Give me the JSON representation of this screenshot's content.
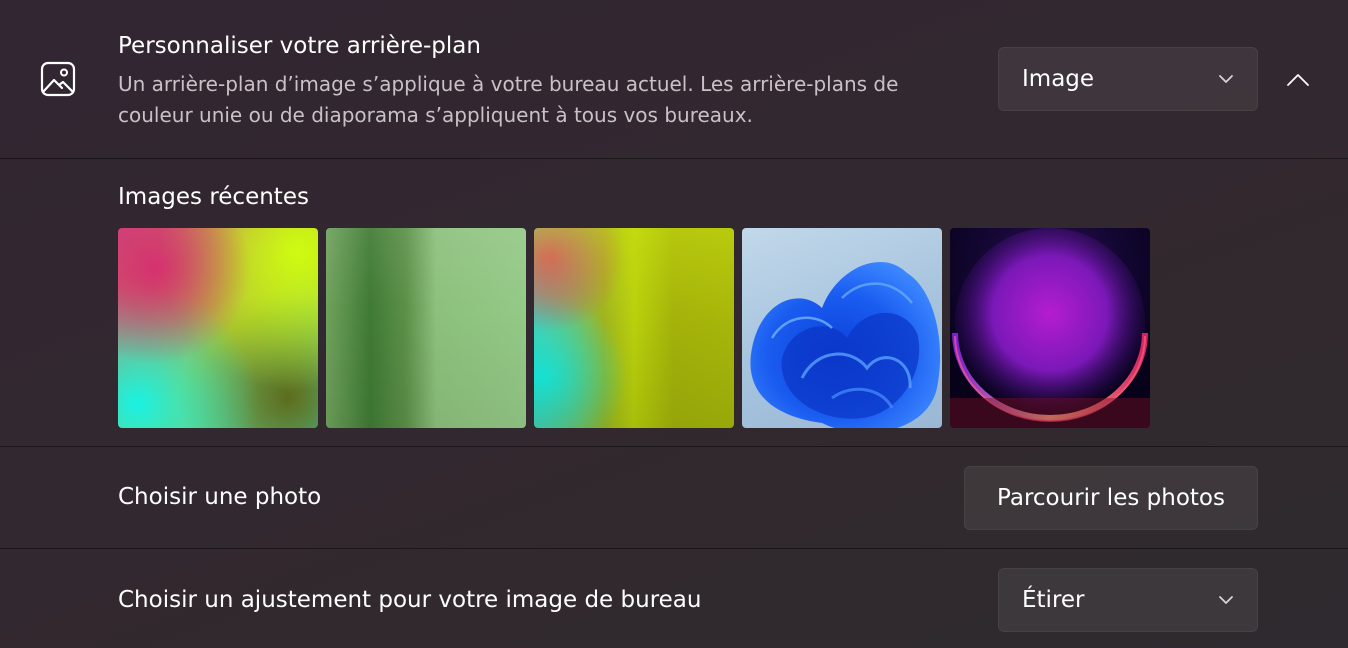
{
  "header": {
    "title": "Personnaliser votre arrière-plan",
    "description": "Un arrière-plan d’image s’applique à votre bureau actuel. Les arrière-plans de couleur unie ou de diaporama s’appliquent à tous vos bureaux.",
    "icon": "picture-icon",
    "mode_dropdown": {
      "selected": "Image"
    },
    "collapse_icon": "chevron-up-icon"
  },
  "recent": {
    "label": "Images récentes",
    "thumbnails": [
      {
        "name": "gradient-pink-yellow-cyan"
      },
      {
        "name": "gradient-green"
      },
      {
        "name": "gradient-yellow-cyan"
      },
      {
        "name": "windows-bloom-light"
      },
      {
        "name": "purple-glow-dark"
      }
    ]
  },
  "photo": {
    "label": "Choisir une photo",
    "browse_button": "Parcourir les photos"
  },
  "fit": {
    "label": "Choisir un ajustement pour votre image de bureau",
    "dropdown": {
      "selected": "Étirer"
    }
  },
  "colors": {
    "background": "#2a1f2a",
    "text_primary": "#ffffff",
    "text_secondary": "#c8c2c7"
  }
}
